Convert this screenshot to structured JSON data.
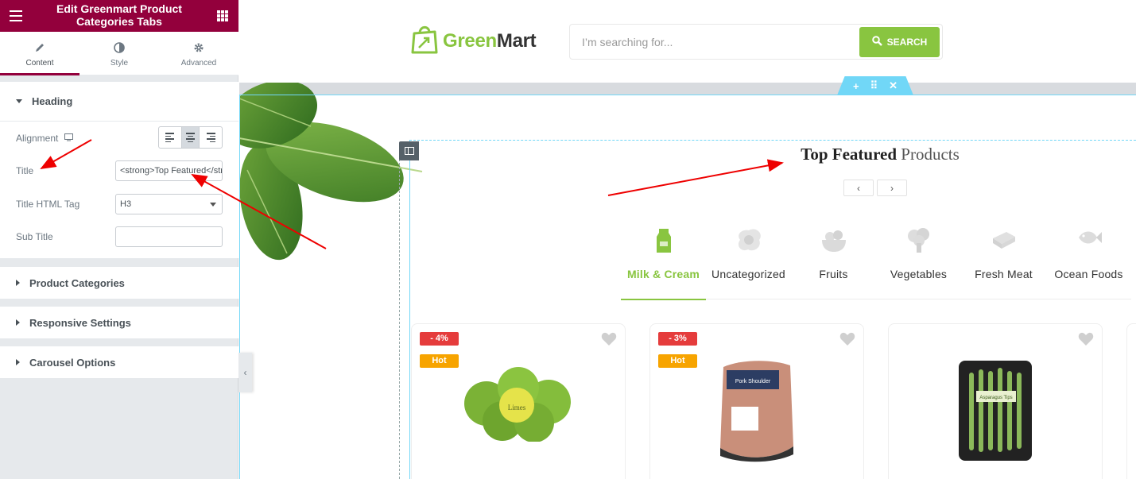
{
  "sidebar": {
    "title": "Edit Greenmart Product Categories Tabs",
    "tabs": [
      {
        "label": "Content",
        "icon": "pencil-icon",
        "active": true
      },
      {
        "label": "Style",
        "icon": "half-circle-icon",
        "active": false
      },
      {
        "label": "Advanced",
        "icon": "gear-icon",
        "active": false
      }
    ],
    "heading_section": {
      "label": "Heading",
      "alignment_label": "Alignment",
      "alignment_selected": "center",
      "title_label": "Title",
      "title_value": "<strong>Top Featured</strong> Products",
      "title_tag_label": "Title HTML Tag",
      "title_tag_value": "H3",
      "subtitle_label": "Sub Title",
      "subtitle_value": ""
    },
    "sections": [
      {
        "label": "Product Categories"
      },
      {
        "label": "Responsive Settings"
      },
      {
        "label": "Carousel Options"
      }
    ]
  },
  "site": {
    "logo_green": "Green",
    "logo_dark": "Mart",
    "search_placeholder": "I’m searching for...",
    "search_button": "SEARCH",
    "brand_color": "#89c540"
  },
  "widget": {
    "title_strong": "Top Featured",
    "title_light": " Products",
    "categories": [
      {
        "label": "Milk & Cream",
        "icon": "milk-carton-icon",
        "active": true
      },
      {
        "label": "Uncategorized",
        "icon": "egg-icon",
        "active": false
      },
      {
        "label": "Fruits",
        "icon": "fruit-bowl-icon",
        "active": false
      },
      {
        "label": "Vegetables",
        "icon": "broccoli-icon",
        "active": false
      },
      {
        "label": "Fresh Meat",
        "icon": "sandwich-icon",
        "active": false
      },
      {
        "label": "Ocean Foods",
        "icon": "fish-icon",
        "active": false
      }
    ],
    "products": [
      {
        "discount": "- 4%",
        "badge": "Hot",
        "image": "limes-bag-image",
        "pack_label": "Limes"
      },
      {
        "discount": "- 3%",
        "badge": "Hot",
        "image": "pork-shoulder-image",
        "pack_label": "Pork Shoulder"
      },
      {
        "image": "asparagus-tray-image",
        "pack_label": "Asparagus Tips"
      }
    ]
  },
  "colors": {
    "editor_accent": "#93003c",
    "selection": "#71d7f7",
    "sale_badge": "#e53c3c",
    "hot_badge": "#f7a400"
  }
}
